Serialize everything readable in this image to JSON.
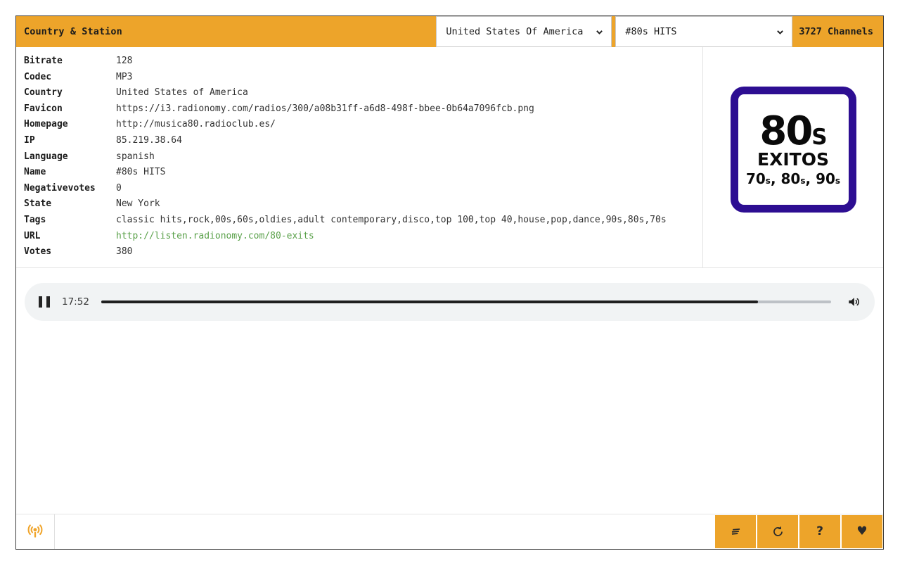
{
  "header": {
    "title": "Country & Station",
    "country_select": {
      "value": "United States Of America",
      "icon": "chevron-down-icon"
    },
    "station_select": {
      "value": "#80s HITS",
      "icon": "chevron-down-icon"
    },
    "channel_count": "3727 Channels"
  },
  "details": {
    "rows": [
      {
        "key": "Bitrate",
        "value": "128",
        "link": false
      },
      {
        "key": "Codec",
        "value": "MP3",
        "link": false
      },
      {
        "key": "Country",
        "value": "United States of America",
        "link": false
      },
      {
        "key": "Favicon",
        "value": "https://i3.radionomy.com/radios/300/a08b31ff-a6d8-498f-bbee-0b64a7096fcb.png",
        "link": false
      },
      {
        "key": "Homepage",
        "value": "http://musica80.radioclub.es/",
        "link": false
      },
      {
        "key": "IP",
        "value": "85.219.38.64",
        "link": false
      },
      {
        "key": "Language",
        "value": "spanish",
        "link": false
      },
      {
        "key": "Name",
        "value": "#80s HITS",
        "link": false
      },
      {
        "key": "Negativevotes",
        "value": "0",
        "link": false
      },
      {
        "key": "State",
        "value": "New York",
        "link": false
      },
      {
        "key": "Tags",
        "value": "classic hits,rock,00s,60s,oldies,adult contemporary,disco,top 100,top 40,house,pop,dance,90s,80s,70s",
        "link": false
      },
      {
        "key": "URL",
        "value": "http://listen.radionomy.com/80-exits",
        "link": true
      },
      {
        "key": "Votes",
        "value": "380",
        "link": false
      }
    ]
  },
  "logo": {
    "name": "station-logo",
    "line1": "80",
    "line1_suffix": "S",
    "line2": "EXITOS",
    "line3_a": "70",
    "line3_a_sm": "s",
    "line3_b": "80",
    "line3_b_sm": "s",
    "line3_c": "90",
    "line3_c_sm": "s",
    "border_color": "#2d0e92"
  },
  "player": {
    "pause_icon": "pause-icon",
    "time": "17:52",
    "progress_percent": 90,
    "volume_icon": "volume-icon"
  },
  "footer": {
    "radio_icon": "broadcast-tower-icon",
    "buttons": [
      {
        "name": "list-button",
        "icon": "list-lines-icon",
        "glyph": ""
      },
      {
        "name": "refresh-button",
        "icon": "refresh-icon",
        "glyph": ""
      },
      {
        "name": "help-button",
        "icon": "question-icon",
        "glyph": "?"
      },
      {
        "name": "favorite-button",
        "icon": "heart-icon",
        "glyph": "♥"
      }
    ]
  },
  "colors": {
    "accent": "#eda42a",
    "link": "#5aa14a",
    "logo_border": "#2d0e92"
  }
}
